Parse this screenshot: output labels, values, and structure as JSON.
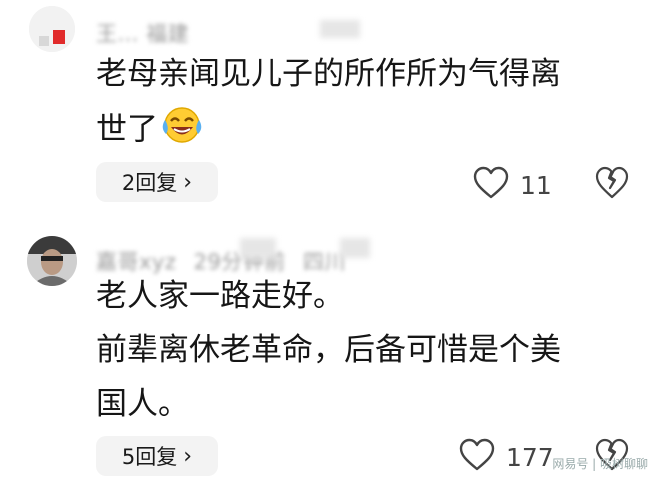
{
  "comment1": {
    "meta_blurred": "王…   福建",
    "text_lines": [
      "老母亲闻见儿子的所作所为气得离",
      "世了"
    ],
    "emoji": "laughing-crying-emoji",
    "replies_label": "2回复",
    "likes": "11"
  },
  "comment2": {
    "user": "嘉哥xyz",
    "time": "29分钟前",
    "location": "四川",
    "text_lines": [
      "老人家一路走好。",
      "前辈离休老革命，后备可惜是个美",
      "国人。"
    ],
    "replies_label": "5回复",
    "likes": "177"
  },
  "watermark": "网易号 | 吸树聊聊"
}
